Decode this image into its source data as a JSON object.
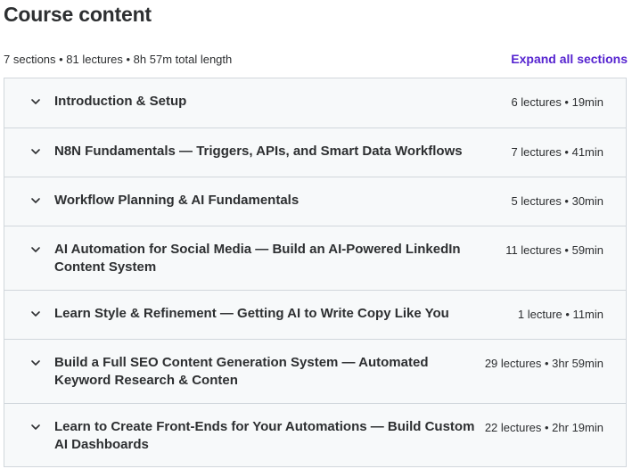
{
  "header": {
    "title": "Course content",
    "summary": "7 sections • 81 lectures • 8h 57m total length",
    "expand_label": "Expand all sections"
  },
  "sections": [
    {
      "title": "Introduction & Setup",
      "meta": "6 lectures • 19min"
    },
    {
      "title": "N8N Fundamentals — Triggers, APIs, and Smart Data Workflows",
      "meta": "7 lectures • 41min"
    },
    {
      "title": "Workflow Planning & AI Fundamentals",
      "meta": "5 lectures • 30min"
    },
    {
      "title": "AI Automation for Social Media — Build an AI-Powered LinkedIn Content System",
      "meta": "11 lectures • 59min"
    },
    {
      "title": "Learn Style & Refinement — Getting AI to Write Copy Like You",
      "meta": "1 lecture • 11min"
    },
    {
      "title": "Build a Full SEO Content Generation System — Automated Keyword Research & Conten",
      "meta": "29 lectures • 3hr 59min"
    },
    {
      "title": "Learn to Create Front-Ends for Your Automations — Build Custom AI Dashboards",
      "meta": "22 lectures • 2hr 19min"
    }
  ],
  "icons": {
    "section_toggle": "chevron-down-icon"
  },
  "colors": {
    "accent": "#5624d0",
    "section_bg": "#f7f9fa",
    "border": "#d1d7dc",
    "text": "#2d2f31"
  }
}
